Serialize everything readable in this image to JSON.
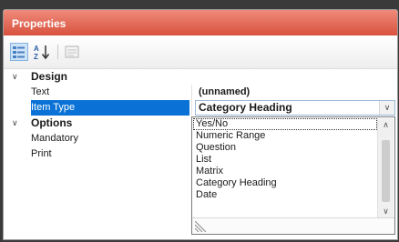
{
  "panel": {
    "title": "Properties",
    "accent_color": "#d8523e"
  },
  "toolbar": {
    "categorized_icon": "categorized-icon",
    "alphabetical_icon": "sort-alphabetical-icon",
    "property_pages_icon": "property-pages-icon"
  },
  "grid": {
    "categories": [
      {
        "label": "Design"
      },
      {
        "label": "Options"
      }
    ],
    "properties": [
      {
        "name": "Text",
        "value": "(unnamed)"
      },
      {
        "name": "Item Type",
        "value": "Category Heading"
      },
      {
        "name": "Mandatory",
        "value": ""
      },
      {
        "name": "Print",
        "value": ""
      }
    ]
  },
  "dropdown": {
    "options": [
      "Yes/No",
      "Numeric Range",
      "Question",
      "List",
      "Matrix",
      "Category Heading",
      "Date"
    ],
    "focused_option": "Yes/No"
  }
}
